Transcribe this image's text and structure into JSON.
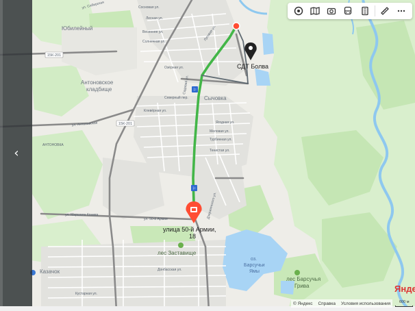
{
  "map": {
    "destination": {
      "name": "СДТ Болва"
    },
    "origin": {
      "name_line1": "улица 50-й Армии,",
      "name_line2": "18"
    },
    "places": {
      "yubileyny": "Юбилейный",
      "antonovskoe": "Антоновское",
      "kladbishche": "кладбище",
      "antonovka": "АНТОНОВКА",
      "bezhitsa": "Сычовка",
      "kazachok": "Казачок",
      "les_zastavishche_1": "лес Заставище",
      "les_barsuchya_1": "лес Барсучья",
      "les_barsuchya_2": "Грива",
      "ozero_1": "оз.",
      "ozero_2": "Барсучьи",
      "ozero_3": "Ямы"
    },
    "roads": {
      "road_1": "15К-201",
      "road_2": "15К-201"
    },
    "streets": [
      "ул. Сибирская",
      "Сосновая ул.",
      "Лесная ул.",
      "Весенняя ул.",
      "Солнечная ул.",
      "Луговая ул.",
      "Озёрная ул.",
      "Садовая ул.",
      "Клевёрная ул.",
      "Меловая ул.",
      "Турбинная ул.",
      "Тенистая ул.",
      "Ягодная ул.",
      "ул. Антоновская",
      "ул. Маршала Конева",
      "ул. 50-й Армии",
      "Северный пер.",
      "Дзержинского ул.",
      "Донбасская ул.",
      "Кустарная ул."
    ]
  },
  "toolbar": {
    "buttons": [
      {
        "name": "layers",
        "icon": "layers-icon"
      },
      {
        "name": "panorama",
        "icon": "panorama-icon"
      },
      {
        "name": "camera",
        "icon": "camera-icon"
      },
      {
        "name": "transport",
        "icon": "bus-icon"
      },
      {
        "name": "traffic",
        "icon": "traffic-icon"
      },
      {
        "name": "ruler",
        "icon": "ruler-icon"
      },
      {
        "name": "more",
        "icon": "more-icon"
      }
    ]
  },
  "attribution": {
    "copyright": "© Яндекс",
    "help": "Справка",
    "terms": "Условия использования",
    "scale": "600 м"
  },
  "brand": "Яндекс",
  "colors": {
    "route": "#43b648",
    "origin_marker": "#ff4d33",
    "destination_marker": "#222222",
    "water": "#a8d4f5",
    "forest": "#d2ecc5",
    "road_main": "#7d7d7d"
  }
}
